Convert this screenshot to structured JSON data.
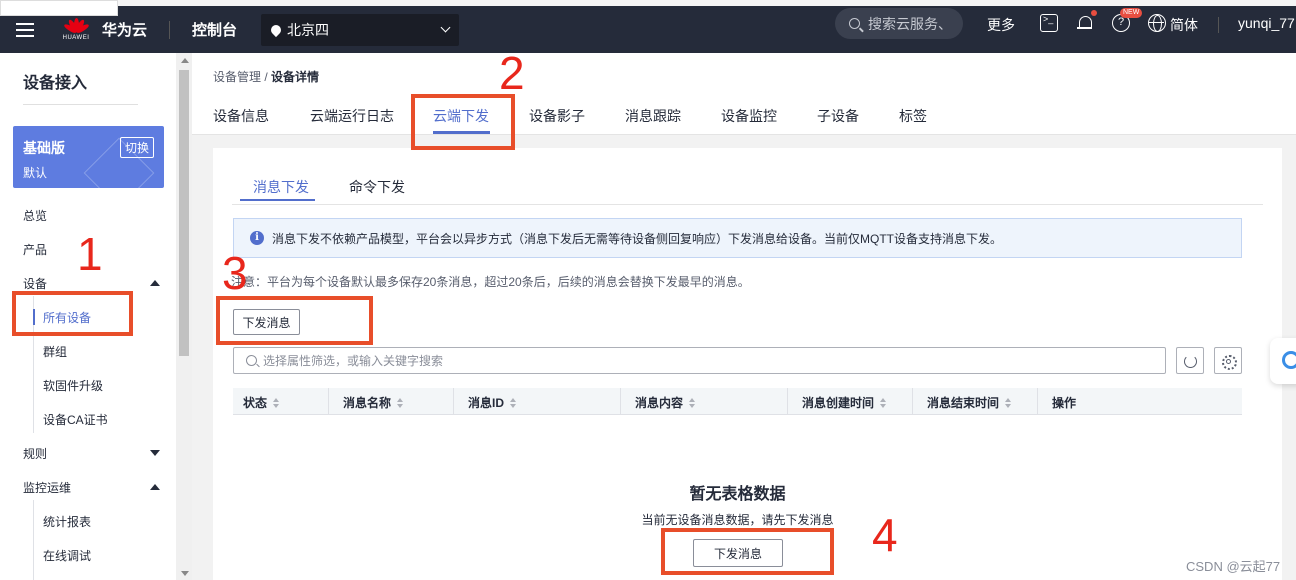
{
  "topbar": {
    "logo_text": "HUAWEI",
    "brand": "华为云",
    "console": "控制台",
    "region": "北京四",
    "search_placeholder": "搜索云服务、",
    "more": "更多",
    "new_badge": "NEW",
    "help_symbol": "?",
    "language": "简体",
    "user": "yunqi_77"
  },
  "sidebar": {
    "title": "设备接入",
    "edition_name": "基础版",
    "edition_switch": "切换",
    "edition_sub": "默认",
    "items": {
      "overview": "总览",
      "product": "产品",
      "device": "设备",
      "all_devices": "所有设备",
      "group": "群组",
      "firmware": "软固件升级",
      "ca_cert": "设备CA证书",
      "rules": "规则",
      "monitor": "监控运维",
      "stats": "统计报表",
      "online_debug": "在线调试"
    }
  },
  "breadcrumb": {
    "parent": "设备管理",
    "sep": " / ",
    "current": "设备详情"
  },
  "tabs": [
    "设备信息",
    "云端运行日志",
    "云端下发",
    "设备影子",
    "消息跟踪",
    "设备监控",
    "子设备",
    "标签"
  ],
  "subtabs": [
    "消息下发",
    "命令下发"
  ],
  "info_icon": "i",
  "info_text": "消息下发不依赖产品模型，平台会以异步方式（消息下发后无需等待设备侧回复响应）下发消息给设备。当前仅MQTT设备支持消息下发。",
  "note_text": "注意：平台为每个设备默认最多保存20条消息，超过20条后，后续的消息会替换下发最早的消息。",
  "send_button": "下发消息",
  "filter_placeholder": "选择属性筛选，或输入关键字搜索",
  "columns": [
    "状态",
    "消息名称",
    "消息ID",
    "消息内容",
    "消息创建时间",
    "消息结束时间",
    "操作"
  ],
  "empty": {
    "title": "暂无表格数据",
    "subtitle": "当前无设备消息数据，请先下发消息",
    "button": "下发消息"
  },
  "annotations": [
    "1",
    "2",
    "3",
    "4"
  ],
  "watermark": "CSDN @云起77",
  "colors": {
    "topbar": "#252b3a",
    "accent": "#526ecc",
    "edition": "#5e7ce0",
    "annotation": "#e84e2a"
  }
}
